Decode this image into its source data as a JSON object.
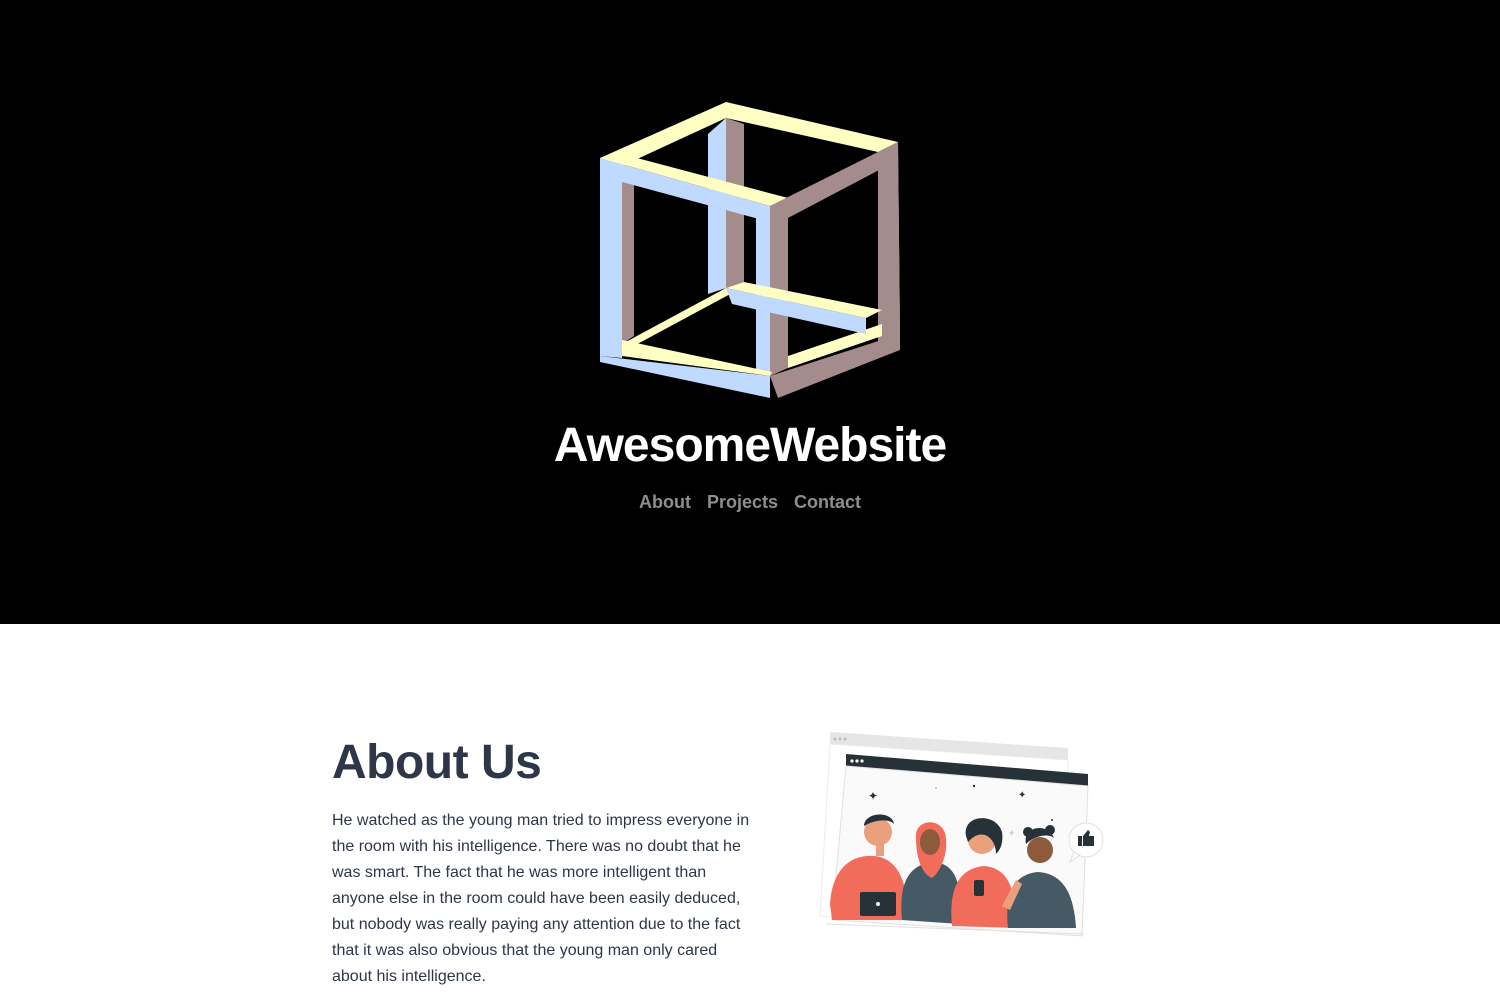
{
  "header": {
    "site_title": "AwesomeWebsite",
    "logo_icon": "impossible-cube-icon",
    "nav": [
      {
        "label": "About"
      },
      {
        "label": "Projects"
      },
      {
        "label": "Contact"
      }
    ]
  },
  "about": {
    "title": "About Us",
    "body": "He watched as the young man tried to impress everyone in the room with his intelligence. There was no doubt that he was smart. The fact that he was more intelligent than anyone else in the room could have been easily deduced, but nobody was really paying any attention due to the fact that it was also obvious that the young man only cared about his intelligence.",
    "illustration": "team-illustration"
  },
  "colors": {
    "hero_bg": "#000000",
    "title": "#ffffff",
    "nav": "#8e8e8e",
    "text": "#2d3748",
    "cube_blue": "#bfd9ff",
    "cube_yellow": "#ffffc4",
    "cube_mauve": "#a58c8c",
    "accent_coral": "#f26c5c"
  }
}
